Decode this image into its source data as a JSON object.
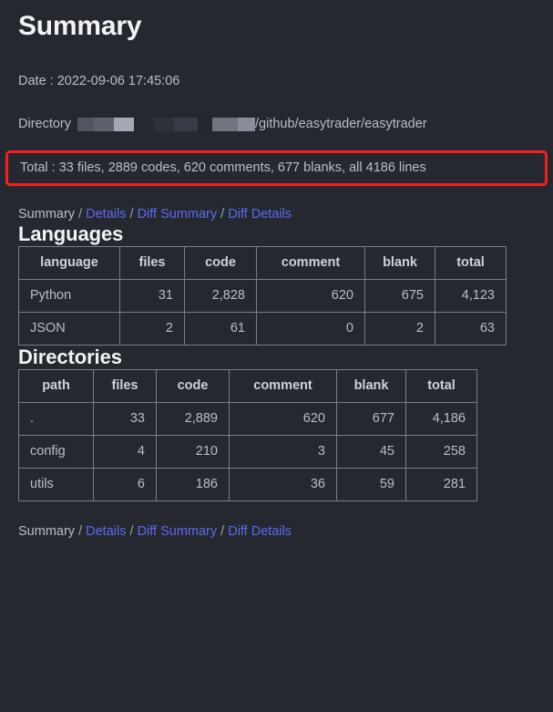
{
  "header": {
    "title": "Summary"
  },
  "meta": {
    "date_label": "Date : ",
    "date_value": "2022-09-06 17:45:06",
    "directory_label": "Directory",
    "directory_redacted_tail": "/github/easytrader/easytrader",
    "total_text": "Total : 33 files, 2889 codes, 620 comments, 677 blanks, all 4186 lines",
    "highlight_color": "#f81f1f"
  },
  "nav": {
    "current_label": "Summary",
    "separator": " / ",
    "links": [
      {
        "label": "Details"
      },
      {
        "label": "Diff Summary"
      },
      {
        "label": "Diff Details"
      }
    ],
    "link_color": "#5c6bf0"
  },
  "languages": {
    "section_title": "Languages",
    "columns": [
      "language",
      "files",
      "code",
      "comment",
      "blank",
      "total"
    ],
    "rows": [
      [
        "Python",
        "31",
        "2,828",
        "620",
        "675",
        "4,123"
      ],
      [
        "JSON",
        "2",
        "61",
        "0",
        "2",
        "63"
      ]
    ]
  },
  "directories": {
    "section_title": "Directories",
    "columns": [
      "path",
      "files",
      "code",
      "comment",
      "blank",
      "total"
    ],
    "rows": [
      [
        ".",
        "33",
        "2,889",
        "620",
        "677",
        "4,186"
      ],
      [
        "config",
        "4",
        "210",
        "3",
        "45",
        "258"
      ],
      [
        "utils",
        "6",
        "186",
        "36",
        "59",
        "281"
      ]
    ]
  }
}
